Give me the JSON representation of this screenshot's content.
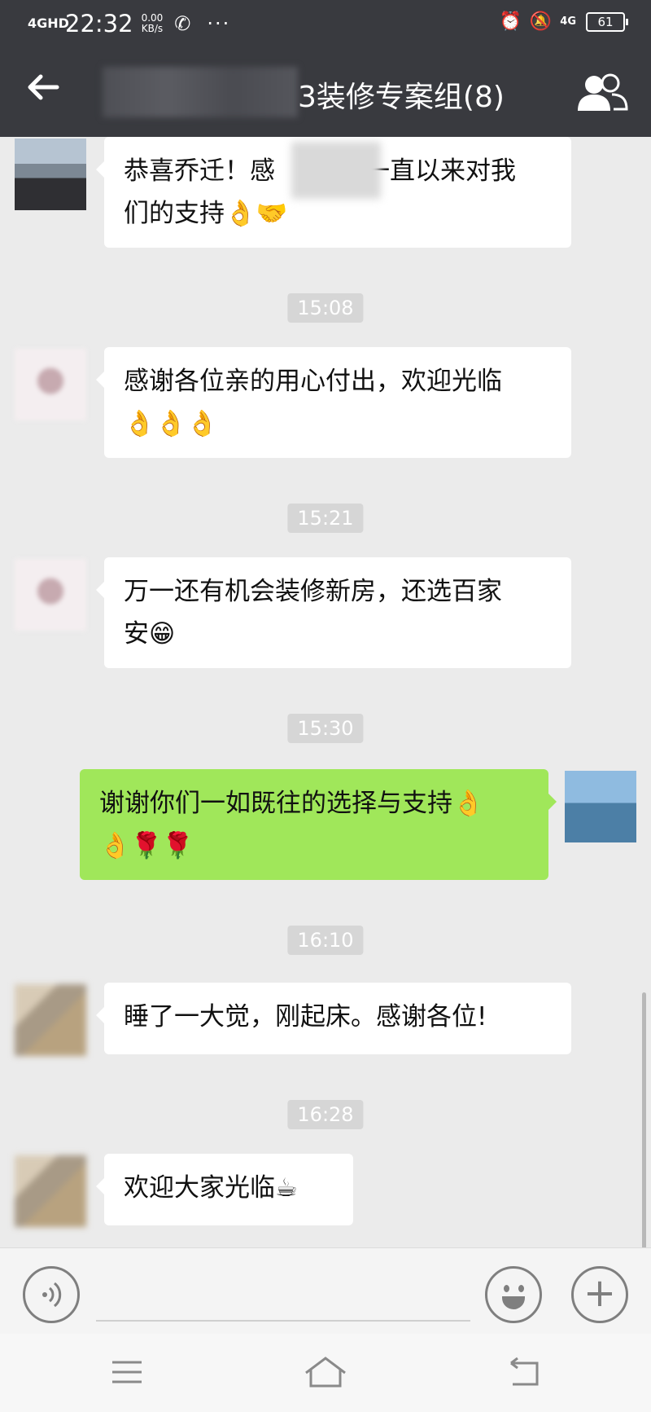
{
  "status_bar": {
    "signal": "4GHD",
    "time": "22:32",
    "speed_value": "0.00",
    "speed_unit": "KB/s",
    "more": "···",
    "network": "4G",
    "battery": "61"
  },
  "header": {
    "title": "3装修专案组(8)",
    "back_icon": "arrow-left-icon",
    "members_icon": "group-icon"
  },
  "messages": [
    {
      "side": "left",
      "text_line1": "恭喜乔迁！感",
      "text_line1b": "一直以来对我",
      "text_line2": "们的支持",
      "emoji": "👌🤝"
    },
    {
      "time": "15:08"
    },
    {
      "side": "left",
      "text_line1": "感谢各位亲的用心付出，欢迎光临",
      "emoji": "👌👌👌"
    },
    {
      "time": "15:21"
    },
    {
      "side": "left",
      "text_line1": "万一还有机会装修新房，还选百家",
      "text_line2": "安",
      "emoji": "😁"
    },
    {
      "time": "15:30"
    },
    {
      "side": "right",
      "text_line1": "谢谢你们一如既往的选择与支持",
      "emoji_line1": "👌",
      "emoji": "👌🌹🌹"
    },
    {
      "time": "16:10"
    },
    {
      "side": "left",
      "text_line1": "睡了一大觉，刚起床。感谢各位!"
    },
    {
      "time": "16:28"
    },
    {
      "side": "left",
      "text_line1": "欢迎大家光临",
      "emoji": "☕"
    }
  ],
  "input_bar": {
    "voice_icon": "voice-icon",
    "emoji_icon": "smiley-icon",
    "plus_icon": "plus-icon"
  },
  "nav_bar": {
    "menu_icon": "menu-icon",
    "home_icon": "home-icon",
    "back_icon": "back-icon"
  }
}
